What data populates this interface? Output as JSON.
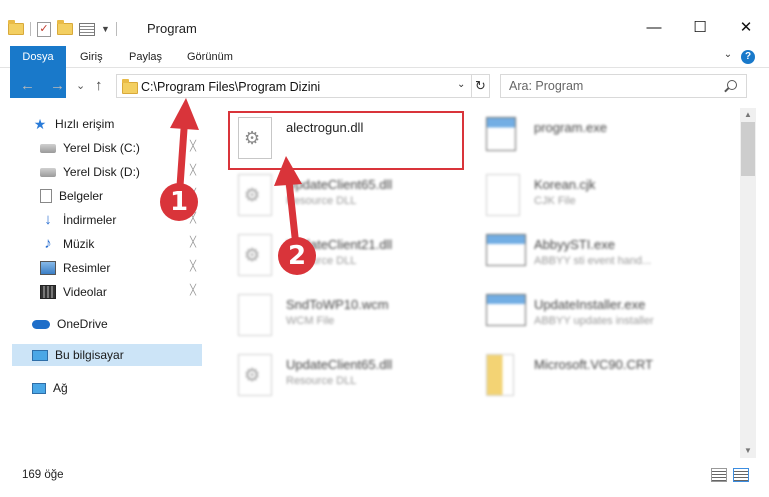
{
  "window": {
    "title": "Program",
    "minimize": "—",
    "maximize": "☐",
    "close": "✕"
  },
  "ribbon": {
    "tabs": [
      "Dosya",
      "Giriş",
      "Paylaş",
      "Görünüm"
    ],
    "expand": "⌄",
    "help": "?"
  },
  "nav": {
    "back": "←",
    "forward": "→",
    "recent": "⌄",
    "up": "↑"
  },
  "address": {
    "path": "C:\\Program Files\\Program Dizini",
    "dropdown": "⌄",
    "refresh": "↻"
  },
  "search": {
    "placeholder": "Ara: Program"
  },
  "sidebar": {
    "items": [
      {
        "label": "Hızlı erişim",
        "icon": "star-icon"
      },
      {
        "label": "Yerel Disk (C:)",
        "icon": "disk-icon",
        "pinned": true
      },
      {
        "label": "Yerel Disk (D:)",
        "icon": "disk-icon",
        "pinned": true
      },
      {
        "label": "Belgeler",
        "icon": "documents-icon",
        "pinned": true
      },
      {
        "label": "İndirmeler",
        "icon": "downloads-icon",
        "pinned": true
      },
      {
        "label": "Müzik",
        "icon": "music-icon",
        "pinned": true
      },
      {
        "label": "Resimler",
        "icon": "pictures-icon",
        "pinned": true
      },
      {
        "label": "Videolar",
        "icon": "videos-icon",
        "pinned": true
      },
      {
        "label": "OneDrive",
        "icon": "onedrive-icon"
      },
      {
        "label": "Bu bilgisayar",
        "icon": "computer-icon",
        "selected": true
      },
      {
        "label": "Ağ",
        "icon": "network-icon"
      }
    ],
    "pin_glyph": "📌"
  },
  "files": [
    {
      "name": "alectrogun.dll",
      "type": ""
    },
    {
      "name": "program.exe",
      "type": ""
    },
    {
      "name": "UpdateClient65.dll",
      "type": "Resource DLL"
    },
    {
      "name": "Korean.cjk",
      "type": "CJK File"
    },
    {
      "name": "UpdateClient21.dll",
      "type": "Resource DLL"
    },
    {
      "name": "AbbyySTI.exe",
      "type": "ABBYY sti event hand..."
    },
    {
      "name": "SndToWP10.wcm",
      "type": "WCM File"
    },
    {
      "name": "UpdateInstaller.exe",
      "type": "ABBYY updates installer"
    },
    {
      "name": "UpdateClient65.dll",
      "type": "Resource DLL"
    },
    {
      "name": "Microsoft.VC90.CRT",
      "type": ""
    }
  ],
  "gear_glyph": "⚙",
  "callouts": [
    "1",
    "2"
  ],
  "status": {
    "count": "169 öğe"
  },
  "colors": {
    "accent": "#1979ca",
    "highlight": "#d9343a",
    "selection": "#cce4f7"
  }
}
